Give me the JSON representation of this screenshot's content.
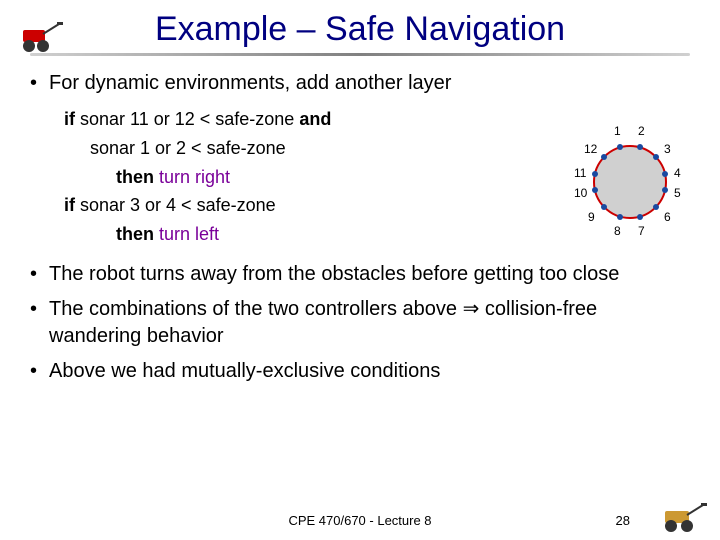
{
  "title": "Example – Safe Navigation",
  "bullets": {
    "b1": "For dynamic environments, add another layer",
    "b2": "The robot turns away from the obstacles before getting too close",
    "b3_a": "The combinations of the two controllers above ",
    "b3_sym": "⇒",
    "b3_b": " collision-free wandering behavior",
    "b4": "Above we had mutually-exclusive conditions"
  },
  "pseudo": {
    "l1_if": "if",
    "l1_cond": " sonar 11 or 12 < safe-zone ",
    "l1_and": "and",
    "l2": "sonar 1 or 2 < safe-zone",
    "l3_then": "then",
    "l3_act": " turn right",
    "l4_if": "if",
    "l4_cond": " sonar 3 or 4 < safe-zone",
    "l5_then": "then",
    "l5_act": " turn left"
  },
  "sensors": {
    "s1": "1",
    "s2": "2",
    "s3": "3",
    "s4": "4",
    "s5": "5",
    "s6": "6",
    "s7": "7",
    "s8": "8",
    "s9": "9",
    "s10": "10",
    "s11": "11",
    "s12": "12"
  },
  "footer": "CPE 470/670 - Lecture 8",
  "page": "28"
}
